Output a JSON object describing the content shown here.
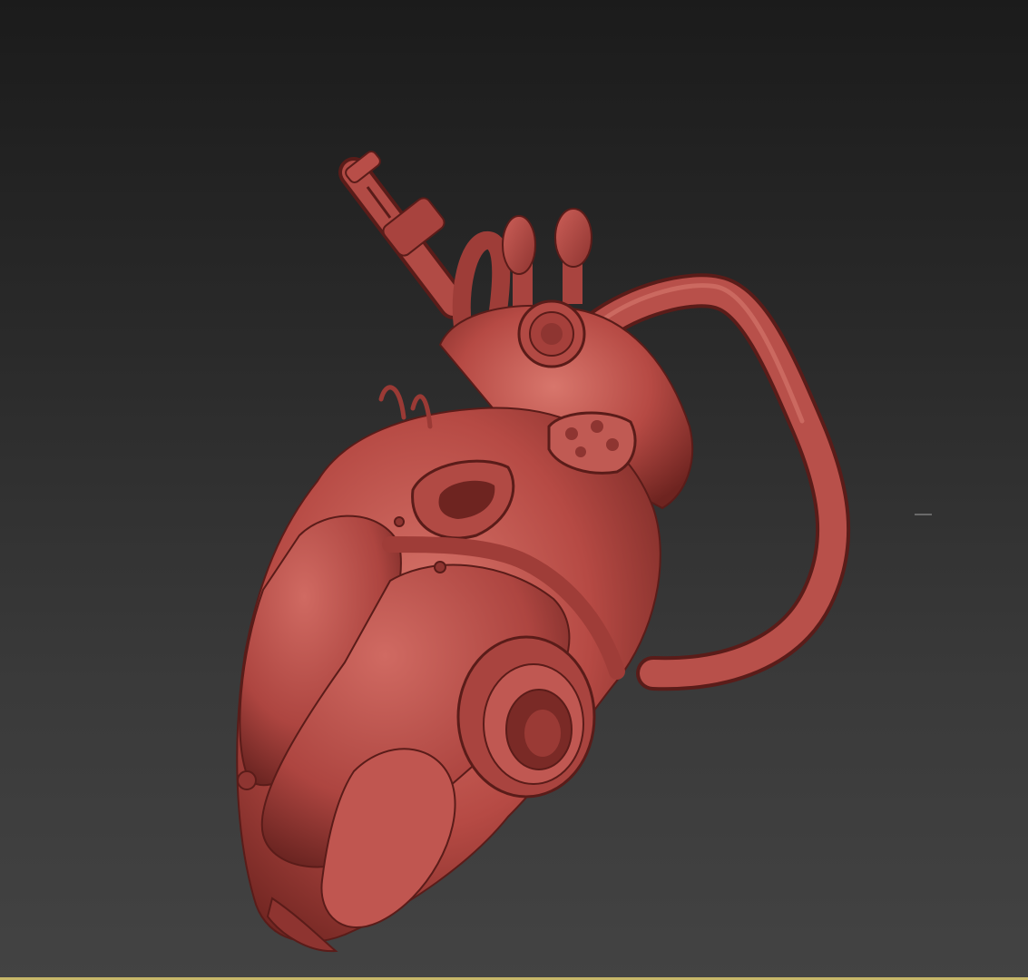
{
  "viewport": {
    "background_top": "#1b1b1b",
    "background_bottom": "#434343",
    "border_color": "#c8b86a",
    "active": true
  },
  "model": {
    "shading": "clay",
    "base_color": "#b64a44",
    "shadow_color": "#6e2420",
    "highlight_color": "#d8766c"
  },
  "icons": {
    "model": "mechanical-heart-model"
  }
}
